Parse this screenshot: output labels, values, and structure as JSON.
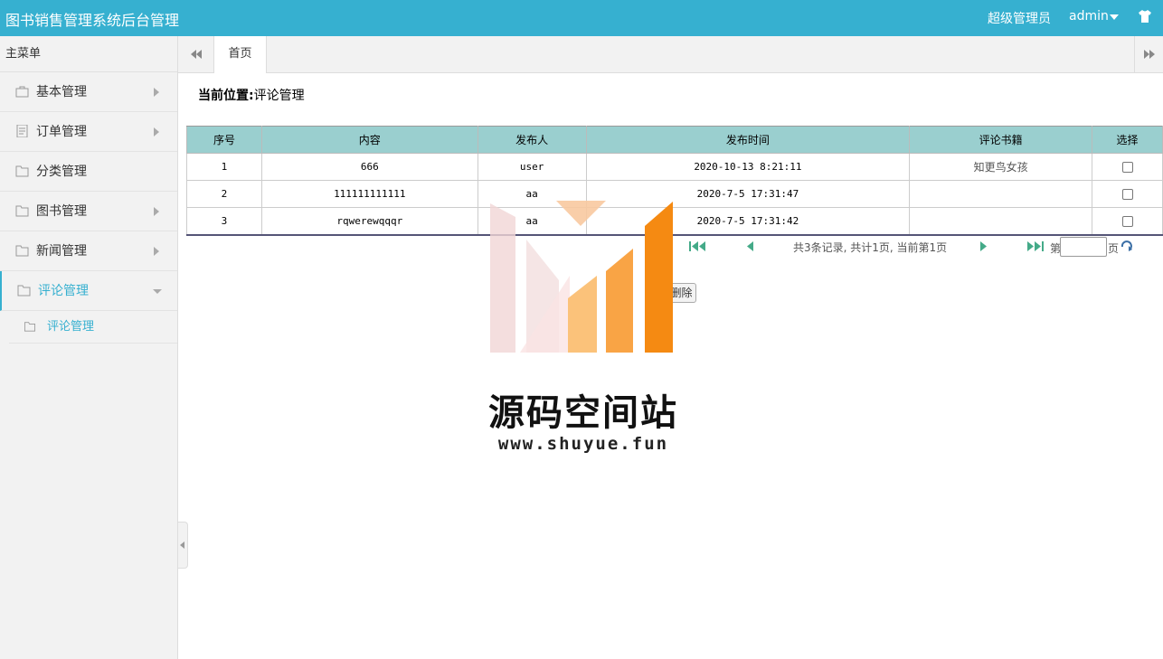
{
  "header": {
    "title": "图书销售管理系统后台管理",
    "role": "超级管理员",
    "user": "admin"
  },
  "sidebar": {
    "head": "主菜单",
    "items": [
      {
        "label": "基本管理",
        "icon": "bag-icon"
      },
      {
        "label": "订单管理",
        "icon": "document-icon"
      },
      {
        "label": "分类管理",
        "icon": "folder-icon"
      },
      {
        "label": "图书管理",
        "icon": "folder-icon"
      },
      {
        "label": "新闻管理",
        "icon": "folder-icon"
      },
      {
        "label": "评论管理",
        "icon": "folder-icon"
      }
    ],
    "sub_items": [
      {
        "label": "评论管理"
      }
    ]
  },
  "tabs": {
    "home": "首页"
  },
  "crumb": {
    "prefix": "当前位置:",
    "value": "评论管理"
  },
  "table": {
    "headers": [
      "序号",
      "内容",
      "发布人",
      "发布时间",
      "评论书籍",
      "选择"
    ],
    "rows": [
      {
        "no": "1",
        "content": "666",
        "author": "user",
        "time": "2020-10-13 8:21:11",
        "book": "知更鸟女孩"
      },
      {
        "no": "2",
        "content": "111111111111",
        "author": "aa",
        "time": "2020-7-5 17:31:47",
        "book": ""
      },
      {
        "no": "3",
        "content": "rqwerewqqqr",
        "author": "aa",
        "time": "2020-7-5 17:31:42",
        "book": ""
      }
    ]
  },
  "pager": {
    "info": "共3条记录, 共计1页, 当前第1页",
    "jump_pre": "第",
    "jump_post": "页"
  },
  "actions": {
    "delete": "删除"
  },
  "watermark": {
    "name": "源码空间站",
    "url": "www.shuyue.fun"
  },
  "colors": {
    "accent": "#36b0d0",
    "table_header": "#9acfcf"
  }
}
